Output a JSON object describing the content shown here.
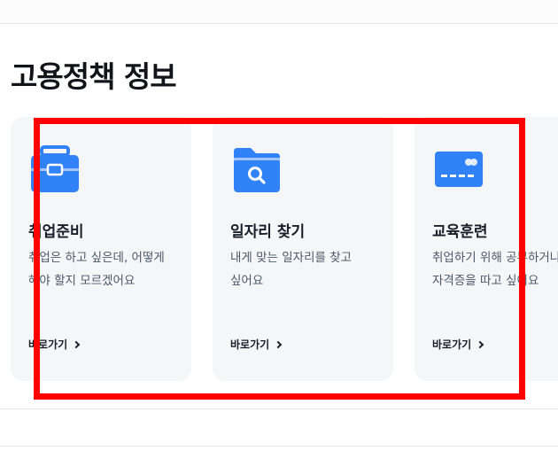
{
  "section": {
    "title": "고용정책 정보"
  },
  "cards": [
    {
      "title": "취업준비",
      "description": "취업은 하고 싶은데, 어떻게 해야 할지 모르겠어요",
      "link_label": "바로가기",
      "icon": "briefcase-icon"
    },
    {
      "title": "일자리 찾기",
      "description": "내게 맞는 일자리를 찾고 싶어요",
      "link_label": "바로가기",
      "icon": "folder-search-icon"
    },
    {
      "title": "교육훈련",
      "description": "취업하기 위해 공부하거나 자격증을 따고 싶어요",
      "link_label": "바로가기",
      "icon": "credit-card-icon"
    }
  ],
  "colors": {
    "icon_blue": "#3182f6",
    "card_bg": "#f4f6f8",
    "highlight": "#ff0000"
  }
}
